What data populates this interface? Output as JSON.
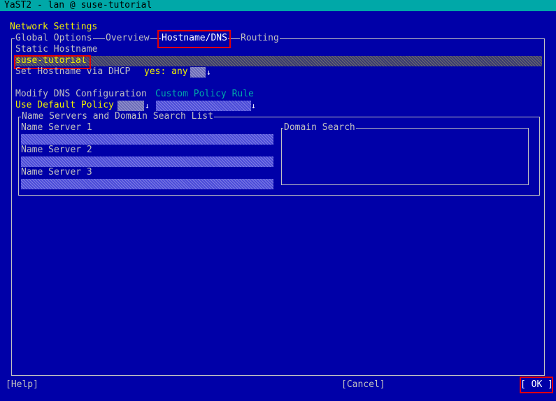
{
  "window": {
    "title": "YaST2 - lan @ suse-tutorial"
  },
  "dialog": {
    "title": "Network Settings"
  },
  "tabs": [
    {
      "label": "Global Options"
    },
    {
      "label": "Overview"
    },
    {
      "label": "Hostname/DNS"
    },
    {
      "label": "Routing"
    }
  ],
  "hostname": {
    "label": "Static Hostname",
    "value": "suse-tutorial",
    "dhcp_label": "Set Hostname via DHCP",
    "dhcp_value": "yes: any"
  },
  "dns": {
    "modify_label": "Modify DNS Configuration",
    "policy_label": "Custom Policy Rule",
    "modify_value": "Use Default Policy",
    "policy_value": ""
  },
  "name_servers": {
    "group_title": "Name Servers and Domain Search List",
    "ns1_label": "Name Server 1",
    "ns2_label": "Name Server 2",
    "ns3_label": "Name Server 3",
    "domain_search_label": "Domain Search"
  },
  "buttons": {
    "help": "[Help]",
    "cancel": "[Cancel]",
    "ok": "[ OK ]"
  },
  "colors": {
    "background": "#0000a8",
    "titlebar": "#00a8a8",
    "highlight": "#f0f000",
    "annotation": "#e00000"
  }
}
